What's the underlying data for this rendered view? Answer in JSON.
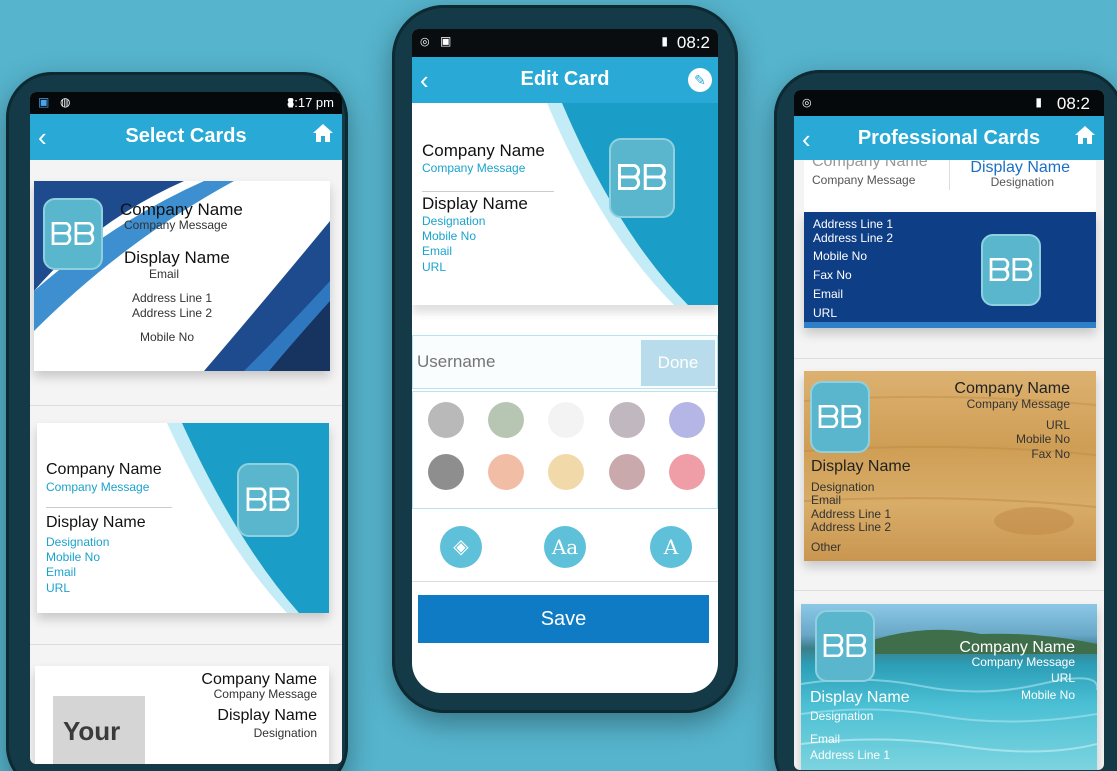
{
  "left_phone": {
    "status_time": "8:17 pm",
    "title": "Select Cards",
    "card1": {
      "company_name": "Company Name",
      "company_message": "Company Message",
      "display_name": "Display Name",
      "email": "Email",
      "address1": "Address Line 1",
      "address2": "Address Line 2",
      "mobile": "Mobile No"
    },
    "card2": {
      "company_name": "Company Name",
      "company_message": "Company Message",
      "display_name": "Display Name",
      "designation": "Designation",
      "mobile": "Mobile No",
      "email": "Email",
      "url": "URL"
    },
    "card3": {
      "company_name": "Company Name",
      "company_message": "Company Message",
      "display_name": "Display Name",
      "designation": "Designation",
      "logo_text": "Your"
    }
  },
  "center_phone": {
    "status_time": "08:2",
    "title": "Edit Card",
    "card": {
      "company_name": "Company Name",
      "company_message": "Company Message",
      "display_name": "Display Name",
      "designation": "Designation",
      "mobile": "Mobile No",
      "email": "Email",
      "url": "URL"
    },
    "input_placeholder": "Username",
    "done_label": "Done",
    "save_label": "Save",
    "swatches": [
      "#b9b9b9",
      "#b7c6b3",
      "#f3f3f3",
      "#c0b7bf",
      "#b5b5e6",
      "#8e8e8e",
      "#f2bda5",
      "#f2d9a9",
      "#c9a9ab",
      "#ef9ea7"
    ],
    "tools": [
      "fill-icon",
      "font-icon",
      "font-size-icon"
    ]
  },
  "right_phone": {
    "status_time": "08:2",
    "title": "Professional Cards",
    "card1": {
      "company_name": "Company Name",
      "company_message": "Company Message",
      "display_name": "Display Name",
      "designation": "Designation"
    },
    "card2": {
      "address1": "Address Line 1",
      "address2": "Address Line 2",
      "mobile": "Mobile No",
      "fax": "Fax No",
      "email": "Email",
      "url": "URL"
    },
    "card3": {
      "company_name": "Company Name",
      "company_message": "Company Message",
      "url": "URL",
      "mobile": "Mobile No",
      "fax": "Fax No",
      "display_name": "Display Name",
      "designation": "Designation",
      "email": "Email",
      "address1": "Address Line 1",
      "address2": "Address Line 2",
      "other": "Other"
    },
    "card4": {
      "company_name": "Company Name",
      "company_message": "Company Message",
      "url": "URL",
      "mobile": "Mobile No",
      "display_name": "Display Name",
      "designation": "Designation",
      "email": "Email",
      "address1": "Address Line 1"
    }
  },
  "colors": {
    "background": "#56b4cd",
    "appbar": "#29a9d5",
    "accent_text": "#1aa3cc",
    "save_button": "#0f7bc4",
    "navy": "#0e3e86",
    "wood": "#d4a660"
  }
}
